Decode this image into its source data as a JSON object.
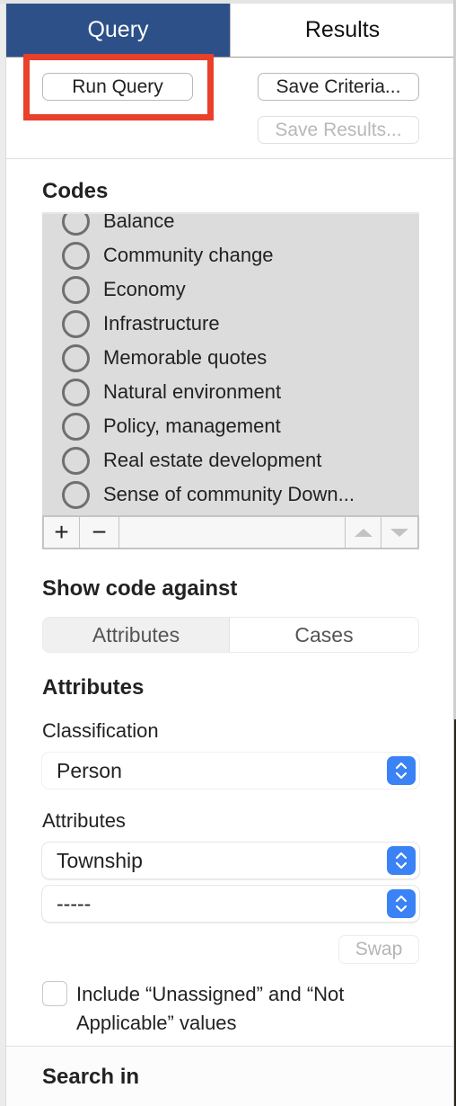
{
  "tabs": [
    {
      "label": "Query",
      "active": true
    },
    {
      "label": "Results",
      "active": false
    }
  ],
  "buttons": {
    "run_query": "Run Query",
    "save_criteria": "Save Criteria...",
    "save_results": "Save Results...",
    "swap": "Swap"
  },
  "codes": {
    "title": "Codes",
    "items": [
      {
        "label": "Balance"
      },
      {
        "label": "Community change"
      },
      {
        "label": "Economy"
      },
      {
        "label": "Infrastructure"
      },
      {
        "label": "Memorable quotes"
      },
      {
        "label": "Natural environment"
      },
      {
        "label": "Policy, management"
      },
      {
        "label": "Real estate development"
      },
      {
        "label": "Sense of community Down..."
      }
    ],
    "toolbar": {
      "add": "+",
      "remove": "−"
    }
  },
  "show_code_against": {
    "title": "Show code against",
    "options": [
      "Attributes",
      "Cases"
    ],
    "selected": "Attributes"
  },
  "attributes": {
    "title": "Attributes",
    "classification_label": "Classification",
    "classification_value": "Person",
    "attributes_label": "Attributes",
    "attribute_1_value": "Township",
    "attribute_2_value": "-----"
  },
  "include_checkbox": {
    "label": "Include “Unassigned” and “Not Applicable” values",
    "checked": false
  },
  "search_in": {
    "title": "Search in"
  },
  "colors": {
    "active_tab": "#2c5087",
    "highlight": "#e8402a",
    "stepper": "#3a82f6",
    "list_bg": "#dcdcdc"
  }
}
